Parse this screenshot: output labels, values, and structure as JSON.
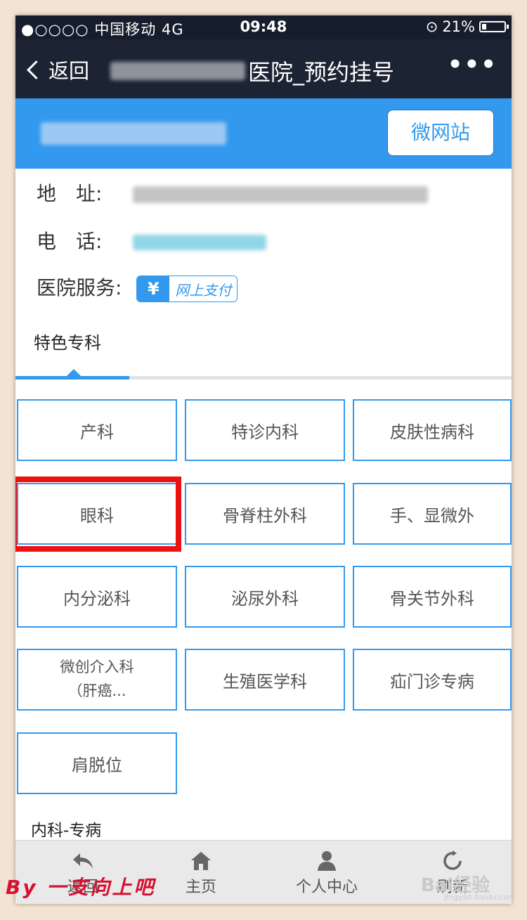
{
  "status_bar": {
    "signal": "●○○○○",
    "carrier": "中国移动",
    "network": "4G",
    "time": "09:48",
    "battery": "21%"
  },
  "nav": {
    "back_label": "返回",
    "title_suffix": "医院_预约挂号",
    "more": "•••"
  },
  "banner": {
    "microsite_button": "微网站"
  },
  "info": {
    "address_label": "地　址:",
    "phone_label": "电　话:",
    "service_label": "医院服务:",
    "pay_icon": "¥",
    "pay_text": "网上支付"
  },
  "featured_title": "特色专科",
  "departments": [
    [
      "产科",
      ""
    ],
    [
      "特诊内科",
      ""
    ],
    [
      "皮肤性病科",
      ""
    ],
    [
      "眼科",
      ""
    ],
    [
      "骨脊柱外科",
      ""
    ],
    [
      "手、显微外",
      ""
    ],
    [
      "内分泌科",
      ""
    ],
    [
      "泌尿外科",
      ""
    ],
    [
      "骨关节外科",
      ""
    ],
    [
      "微创介入科",
      "（肝癌..."
    ],
    [
      "生殖医学科",
      ""
    ],
    [
      "疝门诊专病",
      ""
    ],
    [
      "肩脱位",
      ""
    ]
  ],
  "second_section_title": "内科-专病",
  "bottom_bar": {
    "back": "返回",
    "home": "主页",
    "profile": "个人中心",
    "refresh": "刷新"
  },
  "watermark": {
    "byline": "By 一支向上吧",
    "brand": "Bai经验",
    "brand_sub": "jingyan.baidu.com"
  },
  "colors": {
    "accent": "#3399ee",
    "highlight": "#ee1111",
    "nav_bg": "#1c2333"
  }
}
